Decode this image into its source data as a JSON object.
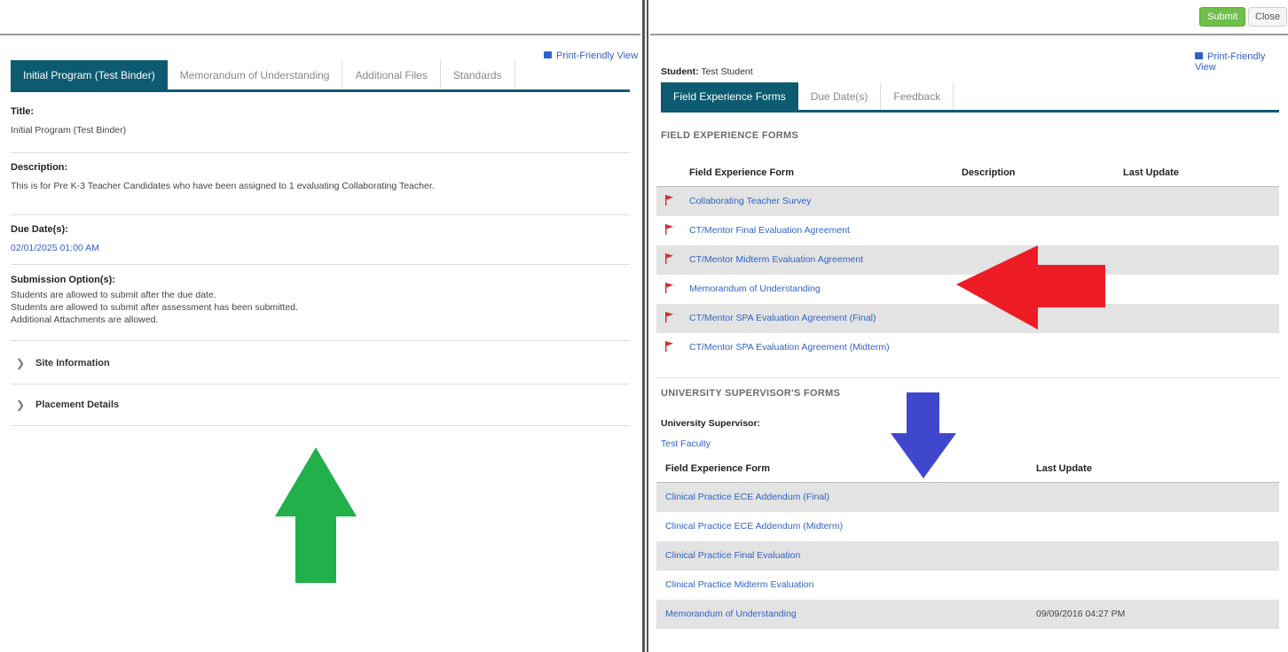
{
  "toolbar": {
    "submit_label": "Submit",
    "close_label": "Close"
  },
  "left": {
    "print_label": "Print-Friendly View",
    "tabs": [
      {
        "label": "Initial Program (Test Binder)",
        "active": true
      },
      {
        "label": "Memorandum of Understanding",
        "active": false
      },
      {
        "label": "Additional Files",
        "active": false
      },
      {
        "label": "Standards",
        "active": false
      }
    ],
    "title_label": "Title:",
    "title_value": "Initial Program (Test Binder)",
    "description_label": "Description:",
    "description_value": "This is for Pre K-3 Teacher Candidates who have been assigned to 1 evaluating Collaborating Teacher.",
    "due_label": "Due Date(s):",
    "due_value": "02/01/2025 01:00 AM",
    "submission_label": "Submission Option(s):",
    "submission_options": [
      "Students are allowed to submit after the due date.",
      "Students are allowed to submit after assessment has been submitted.",
      "Additional Attachments are allowed."
    ],
    "site_info_label": "Site Information",
    "placement_label": "Placement Details"
  },
  "right": {
    "print_label": "Print-Friendly View",
    "student_label": "Student:",
    "student_value": "Test Student",
    "tabs": [
      {
        "label": "Field Experience Forms",
        "active": true
      },
      {
        "label": "Due Date(s)",
        "active": false
      },
      {
        "label": "Feedback",
        "active": false
      }
    ],
    "fe_section_title": "FIELD EXPERIENCE FORMS",
    "fe_headers": {
      "form": "Field Experience Form",
      "description": "Description",
      "last_update": "Last Update"
    },
    "fe_forms": [
      {
        "name": "Collaborating Teacher Survey",
        "shaded": true
      },
      {
        "name": "CT/Mentor Final Evaluation Agreement",
        "shaded": false
      },
      {
        "name": "CT/Mentor Midterm Evaluation Agreement",
        "shaded": true
      },
      {
        "name": "Memorandum of Understanding",
        "shaded": false
      },
      {
        "name": "CT/Mentor SPA Evaluation Agreement (Final)",
        "shaded": true
      },
      {
        "name": "CT/Mentor SPA Evaluation Agreement (Midterm)",
        "shaded": false
      }
    ],
    "us_section_title": "UNIVERSITY SUPERVISOR'S FORMS",
    "us_label": "University Supervisor:",
    "us_value": "Test Faculty",
    "us_headers": {
      "form": "Field Experience Form",
      "last_update": "Last Update"
    },
    "us_forms": [
      {
        "name": "Clinical Practice ECE Addendum (Final)",
        "date": "",
        "shaded": true
      },
      {
        "name": "Clinical Practice ECE Addendum (Midterm)",
        "date": "",
        "shaded": false
      },
      {
        "name": "Clinical Practice Final Evaluation",
        "date": "",
        "shaded": true
      },
      {
        "name": "Clinical Practice Midterm Evaluation",
        "date": "",
        "shaded": false
      },
      {
        "name": "Memorandum of Understanding",
        "date": "09/09/2016 04:27 PM",
        "shaded": true
      }
    ]
  },
  "colors": {
    "tab_active": "#0d5b70",
    "link": "#2f63c9",
    "flag": "#d62b2b",
    "submit": "#6fbf4a",
    "arrow_green": "#22b04b",
    "arrow_red": "#ed1c24",
    "arrow_blue": "#3f48cc"
  },
  "icons": {
    "print": "printer-icon",
    "flag": "flag-icon",
    "chevron": "chevron-right-icon"
  }
}
